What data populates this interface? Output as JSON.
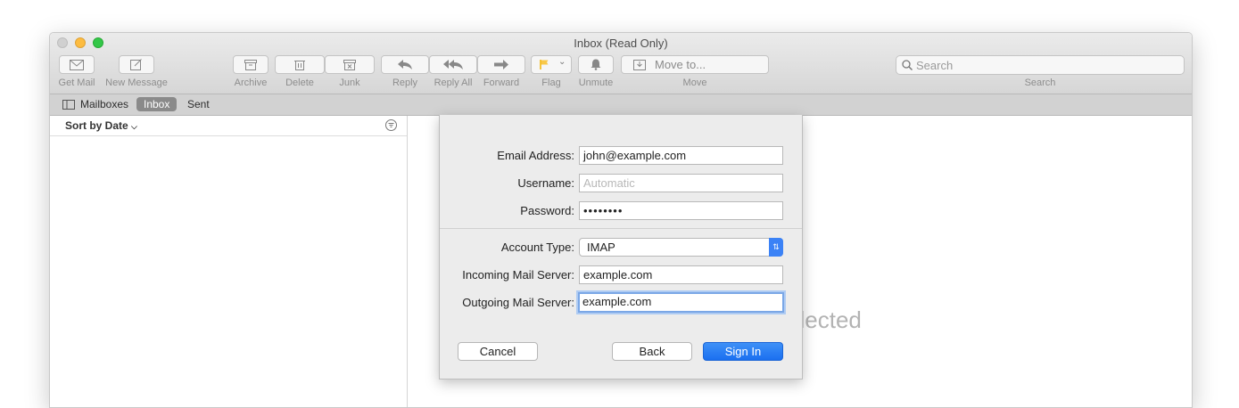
{
  "window": {
    "title": "Inbox (Read Only)"
  },
  "toolbar": {
    "get_mail": "Get Mail",
    "new_message": "New Message",
    "archive": "Archive",
    "delete": "Delete",
    "junk": "Junk",
    "reply": "Reply",
    "reply_all": "Reply All",
    "forward": "Forward",
    "flag": "Flag",
    "unmute": "Unmute",
    "move_to": "Move to...",
    "move": "Move",
    "search_placeholder": "Search",
    "search": "Search"
  },
  "favorites": {
    "mailboxes": "Mailboxes",
    "inbox": "Inbox",
    "sent": "Sent"
  },
  "list": {
    "sort": "Sort by Date"
  },
  "viewer": {
    "empty_text": "No Message Selected",
    "visible_text": "e Selected"
  },
  "sheet": {
    "email_label": "Email Address:",
    "email_value": "john@example.com",
    "username_label": "Username:",
    "username_placeholder": "Automatic",
    "password_label": "Password:",
    "password_value": "••••••••",
    "account_type_label": "Account Type:",
    "account_type_value": "IMAP",
    "incoming_label": "Incoming Mail Server:",
    "incoming_value": "example.com",
    "outgoing_label": "Outgoing Mail Server:",
    "outgoing_value": "example.com",
    "cancel": "Cancel",
    "back": "Back",
    "sign_in": "Sign In"
  }
}
